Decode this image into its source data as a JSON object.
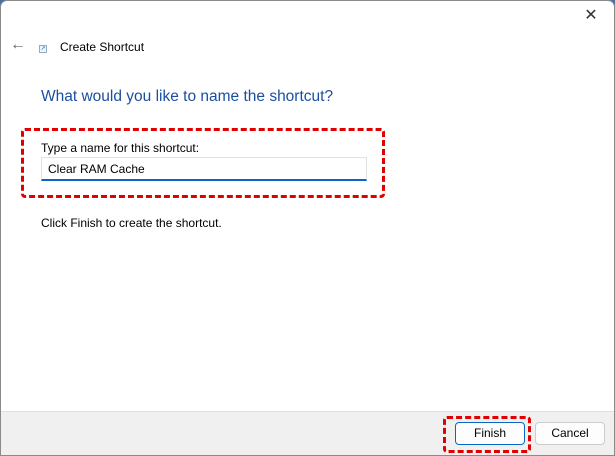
{
  "window": {
    "title": "Create Shortcut",
    "close_glyph": "✕",
    "back_glyph": "←"
  },
  "main": {
    "heading": "What would you like to name the shortcut?",
    "name_label": "Type a name for this shortcut:",
    "name_value": "Clear RAM Cache",
    "hint": "Click Finish to create the shortcut."
  },
  "footer": {
    "finish_label": "Finish",
    "cancel_label": "Cancel"
  },
  "colors": {
    "accent": "#0a66c2",
    "heading": "#1a4fa0",
    "annotation": "#e00000"
  }
}
